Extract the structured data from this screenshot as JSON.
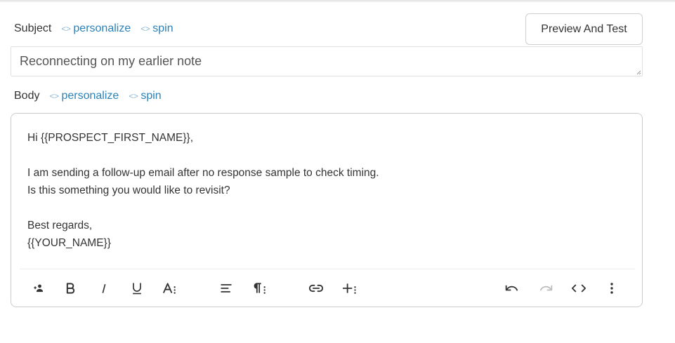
{
  "subject": {
    "label": "Subject",
    "personalize_label": "personalize",
    "spin_label": "spin",
    "value": "Reconnecting on my earlier note",
    "code_glyph": "<>"
  },
  "preview_button": {
    "label": "Preview And Test"
  },
  "body": {
    "label": "Body",
    "personalize_label": "personalize",
    "spin_label": "spin",
    "code_glyph": "<>",
    "lines": [
      "Hi {{PROSPECT_FIRST_NAME}},",
      "",
      "I am sending a follow-up email after no response sample to check timing.",
      "Is this something you would like to revisit?",
      "",
      "Best regards,",
      "{{YOUR_NAME}}"
    ]
  },
  "toolbar": {
    "items": [
      "add-person-icon",
      "bold-icon",
      "italic-icon",
      "underline-icon",
      "text-format-icon",
      "align-icon",
      "paragraph-icon",
      "link-icon",
      "insert-icon",
      "undo-icon",
      "redo-icon",
      "code-view-icon",
      "more-icon"
    ]
  },
  "colors": {
    "link": "#2a82b8",
    "text": "#333333",
    "border": "#cccccc",
    "disabled": "#bdbdbd"
  }
}
